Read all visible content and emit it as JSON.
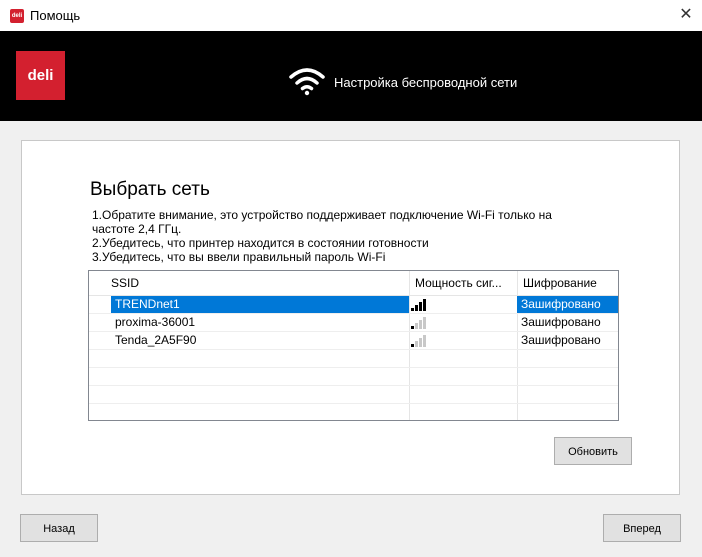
{
  "window": {
    "title": "Помощь",
    "app_icon_text": "deli"
  },
  "header": {
    "logo_text": "deli",
    "title": "Настройка беспроводной сети"
  },
  "content": {
    "title": "Выбрать сеть",
    "notes": [
      "1.Обратите внимание, это устройство поддерживает подключение Wi-Fi только на",
      "частоте 2,4 ГГц.",
      "2.Убедитесь, что принтер находится в состоянии готовности",
      "3.Убедитесь, что вы ввели правильный пароль Wi-Fi"
    ]
  },
  "network_list": {
    "columns": [
      "SSID",
      "Мощность сиг...",
      "Шифрование"
    ],
    "rows": [
      {
        "ssid": "TRENDnet1",
        "signal_bars": 4,
        "encryption": "Зашифровано",
        "selected": true
      },
      {
        "ssid": "proxima-36001",
        "signal_bars": 1,
        "encryption": "Зашифровано",
        "selected": false
      },
      {
        "ssid": "Tenda_2A5F90",
        "signal_bars": 1,
        "encryption": "Зашифровано",
        "selected": false
      }
    ]
  },
  "buttons": {
    "refresh": "Обновить",
    "back": "Назад",
    "next": "Вперед"
  },
  "colors": {
    "brand": "#d3202f",
    "header_bg": "#000000",
    "selection": "#0078d7"
  }
}
